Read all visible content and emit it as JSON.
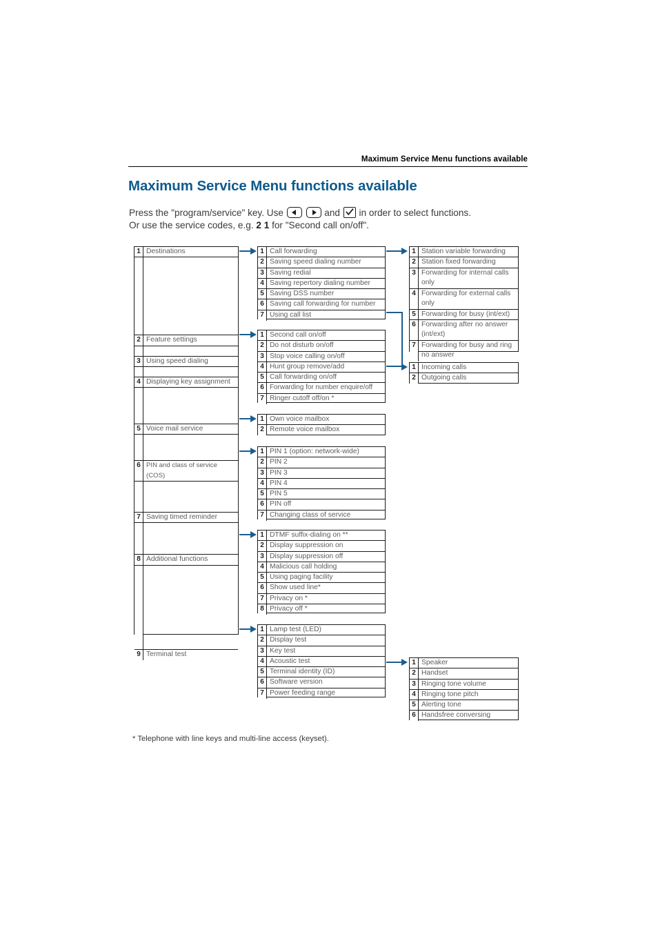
{
  "header": {
    "running_head": "Maximum Service Menu functions available"
  },
  "title": "Maximum Service Menu functions available",
  "intro": {
    "line1_a": "Press the \"program/service\" key. Use",
    "line1_b": "and",
    "line1_c": "in order to select functions.",
    "line2_a": "Or use the service codes, e.g.",
    "line2_code": "2 1",
    "line2_b": "for \"Second call on/off\"."
  },
  "icons": {
    "left_key": "arrow-left-key-icon",
    "right_key": "arrow-right-key-icon",
    "ok_key": "checkmark-key-icon"
  },
  "colors": {
    "title": "#0e5b8e",
    "arrow": "#1a5d8f",
    "border": "#1a1a1a",
    "label": "#5d5d5d"
  },
  "menu": {
    "level1": [
      {
        "num": "1",
        "label": "Destinations"
      },
      {
        "num": "2",
        "label": "Feature settings"
      },
      {
        "num": "3",
        "label": "Using speed dialing"
      },
      {
        "num": "4",
        "label": "Displaying key assignment"
      },
      {
        "num": "5",
        "label": "Voice mail service"
      },
      {
        "num": "6",
        "label": "PIN and class of service (COS)"
      },
      {
        "num": "7",
        "label": "Saving timed reminder"
      },
      {
        "num": "8",
        "label": "Additional functions"
      },
      {
        "num": "9",
        "label": "Terminal test"
      }
    ],
    "destinations": [
      {
        "num": "1",
        "label": "Call forwarding"
      },
      {
        "num": "2",
        "label": "Saving speed dialing number"
      },
      {
        "num": "3",
        "label": "Saving redial"
      },
      {
        "num": "4",
        "label": "Saving repertory dialing number"
      },
      {
        "num": "5",
        "label": "Saving DSS number"
      },
      {
        "num": "6",
        "label": "Saving call forwarding for number"
      },
      {
        "num": "7",
        "label": "Using call list"
      }
    ],
    "call_forwarding": [
      {
        "num": "1",
        "label": "Station variable forwarding"
      },
      {
        "num": "2",
        "label": "Station fixed forwarding"
      },
      {
        "num": "3",
        "label": "Forwarding for internal calls\nonly"
      },
      {
        "num": "4",
        "label": "Forwarding for external calls\nonly"
      },
      {
        "num": "5",
        "label": "Forwarding for busy (int/ext)"
      },
      {
        "num": "6",
        "label": "Forwarding after no answer\n(int/ext)"
      },
      {
        "num": "7",
        "label": "Forwarding for busy and ring\nno answer"
      }
    ],
    "call_list": [
      {
        "num": "1",
        "label": "Incoming calls"
      },
      {
        "num": "2",
        "label": "Outgoing calls"
      }
    ],
    "feature_settings": [
      {
        "num": "1",
        "label": "Second call on/off"
      },
      {
        "num": "2",
        "label": "Do not disturb on/off"
      },
      {
        "num": "3",
        "label": "Stop voice calling on/off"
      },
      {
        "num": "4",
        "label": "Hunt group remove/add"
      },
      {
        "num": "5",
        "label": "Call forwarding on/off"
      },
      {
        "num": "6",
        "label": "Forwarding for number enquire/off"
      },
      {
        "num": "7",
        "label": "Ringer cutoff off/on *"
      }
    ],
    "voice_mail": [
      {
        "num": "1",
        "label": "Own voice mailbox"
      },
      {
        "num": "2",
        "label": "Remote voice mailbox"
      }
    ],
    "pin_cos": [
      {
        "num": "1",
        "label": "PIN 1 (option: network-wide)"
      },
      {
        "num": "2",
        "label": "PIN 2"
      },
      {
        "num": "3",
        "label": "PIN 3"
      },
      {
        "num": "4",
        "label": "PIN 4"
      },
      {
        "num": "5",
        "label": "PIN 5"
      },
      {
        "num": "6",
        "label": "PIN off"
      },
      {
        "num": "7",
        "label": "Changing class of service"
      }
    ],
    "additional_functions": [
      {
        "num": "1",
        "label": "DTMF suffix-dialing on **"
      },
      {
        "num": "2",
        "label": "Display suppression on"
      },
      {
        "num": "3",
        "label": "Display suppression off"
      },
      {
        "num": "4",
        "label": "Malicious call holding"
      },
      {
        "num": "5",
        "label": "Using paging facility"
      },
      {
        "num": "6",
        "label": "Show used line*"
      },
      {
        "num": "7",
        "label": "Privacy on *"
      },
      {
        "num": "8",
        "label": "Privacy off *"
      }
    ],
    "terminal_test": [
      {
        "num": "1",
        "label": "Lamp test (LED)"
      },
      {
        "num": "2",
        "label": "Display test"
      },
      {
        "num": "3",
        "label": "Key test"
      },
      {
        "num": "4",
        "label": "Acoustic test"
      },
      {
        "num": "5",
        "label": "Terminal identity (ID)"
      },
      {
        "num": "6",
        "label": "Software version"
      },
      {
        "num": "7",
        "label": "Power feeding range"
      }
    ],
    "acoustic_test": [
      {
        "num": "1",
        "label": "Speaker"
      },
      {
        "num": "2",
        "label": "Handset"
      },
      {
        "num": "3",
        "label": "Ringing tone volume"
      },
      {
        "num": "4",
        "label": "Ringing tone pitch"
      },
      {
        "num": "5",
        "label": "Alerting tone"
      },
      {
        "num": "6",
        "label": "Handsfree conversing"
      }
    ]
  },
  "footnote": "* Telephone with line keys and multi-line access (keyset)."
}
